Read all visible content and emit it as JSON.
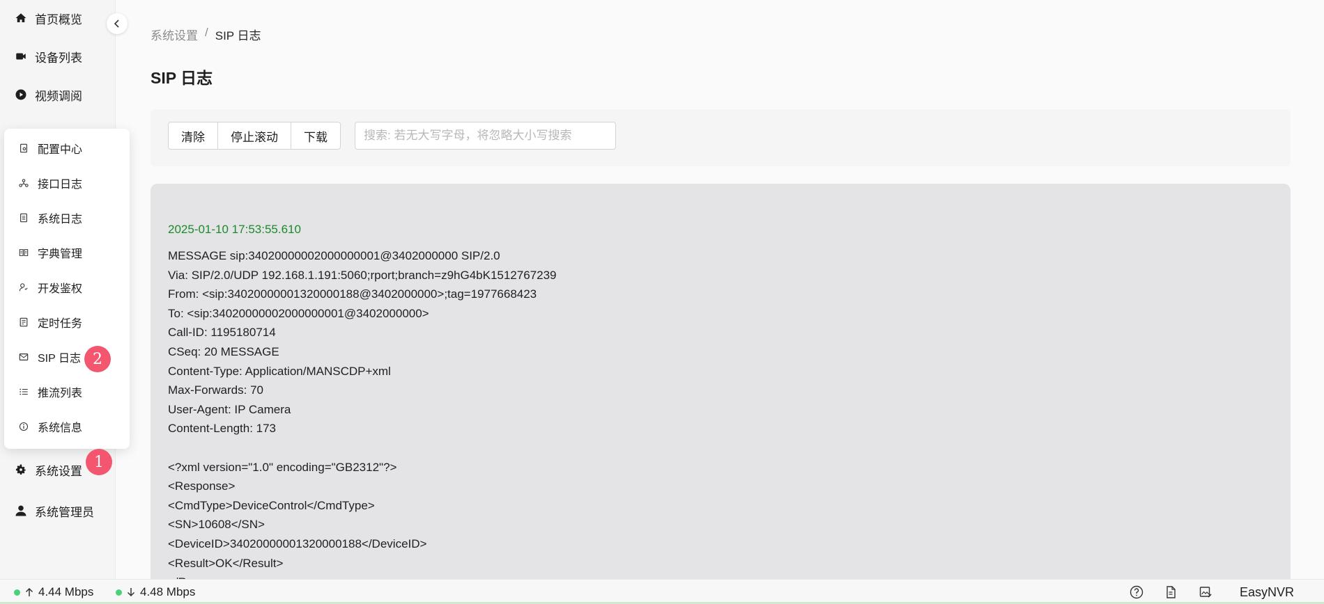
{
  "sidebar": {
    "items": [
      {
        "label": "首页概览",
        "icon": "home-icon"
      },
      {
        "label": "设备列表",
        "icon": "camera-icon"
      },
      {
        "label": "视频调阅",
        "icon": "play-icon"
      },
      {
        "label": "系统设置",
        "icon": "gear-icon"
      },
      {
        "label": "系统管理员",
        "icon": "user-icon"
      }
    ],
    "submenu": [
      {
        "label": "配置中心",
        "icon": "config-icon"
      },
      {
        "label": "接口日志",
        "icon": "api-icon"
      },
      {
        "label": "系统日志",
        "icon": "log-icon"
      },
      {
        "label": "字典管理",
        "icon": "book-icon"
      },
      {
        "label": "开发鉴权",
        "icon": "auth-icon"
      },
      {
        "label": "定时任务",
        "icon": "schedule-icon"
      },
      {
        "label": "SIP 日志",
        "icon": "mail-icon"
      },
      {
        "label": "推流列表",
        "icon": "list-icon"
      },
      {
        "label": "系统信息",
        "icon": "info-icon"
      }
    ],
    "badges": {
      "settings": "1",
      "sip_log": "2"
    }
  },
  "breadcrumb": {
    "parent": "系统设置",
    "separator": "/",
    "current": "SIP 日志"
  },
  "page_title": "SIP 日志",
  "toolbar": {
    "clear_label": "清除",
    "stop_scroll_label": "停止滚动",
    "download_label": "下载",
    "search_placeholder": "搜索: 若无大写字母，将忽略大小写搜索"
  },
  "log": {
    "timestamp": "2025-01-10 17:53:55.610",
    "lines": [
      "MESSAGE sip:34020000002000000001@3402000000 SIP/2.0",
      "Via: SIP/2.0/UDP 192.168.1.191:5060;rport;branch=z9hG4bK1512767239",
      "From: <sip:34020000001320000188@3402000000>;tag=1977668423",
      "To: <sip:34020000002000000001@3402000000>",
      "Call-ID: 1195180714",
      "CSeq: 20 MESSAGE",
      "Content-Type: Application/MANSCDP+xml",
      "Max-Forwards: 70",
      "User-Agent: IP Camera",
      "Content-Length: 173",
      "",
      "<?xml version=\"1.0\" encoding=\"GB2312\"?>",
      "<Response>",
      "<CmdType>DeviceControl</CmdType>",
      "<SN>10608</SN>",
      "<DeviceID>34020000001320000188</DeviceID>",
      "<Result>OK</Result>",
      "</Response>"
    ]
  },
  "status": {
    "upload": "4.44 Mbps",
    "download": "4.48 Mbps",
    "brand": "EasyNVR"
  },
  "colors": {
    "accent_green": "#1a8a2b",
    "badge": "#f3566e",
    "online_dot": "#4cd07a"
  }
}
